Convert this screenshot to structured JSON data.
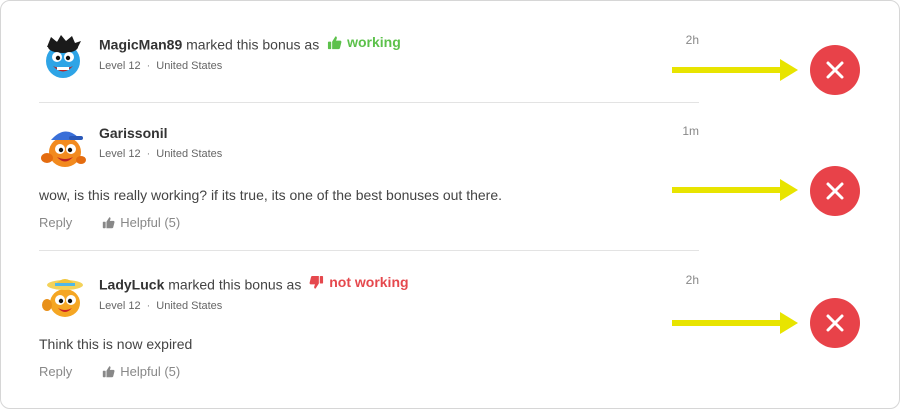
{
  "comments": [
    {
      "username": "MagicMan89",
      "action_text": "marked this bonus as",
      "status_label": "working",
      "level": "Level 12",
      "country": "United States",
      "time": "2h"
    },
    {
      "username": "Garissonil",
      "level": "Level 12",
      "country": "United States",
      "time": "1m",
      "text": "wow, is this really working? if its true, its one of the best bonuses out there.",
      "reply_label": "Reply",
      "helpful_label": "Helpful (5)"
    },
    {
      "username": "LadyLuck",
      "action_text": "marked this bonus as",
      "status_label": "not working",
      "level": "Level 12",
      "country": "United States",
      "time": "2h",
      "text": "Think this is now expired",
      "reply_label": "Reply",
      "helpful_label": "Helpful (5)"
    }
  ],
  "separator": "·",
  "colors": {
    "working": "#5cc14b",
    "not_working": "#e5484d",
    "arrow": "#e8e400",
    "delete_button": "#e84249"
  },
  "icons": {
    "working": "thumbs-up-icon",
    "not_working": "thumbs-down-icon",
    "helpful": "thumbs-up-icon",
    "delete": "close-icon"
  }
}
